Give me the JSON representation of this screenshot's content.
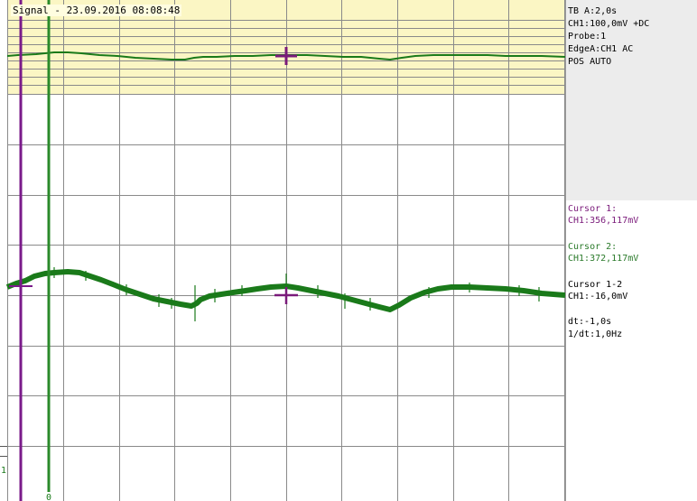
{
  "window": {
    "title": "Signal - 23.09.2016 08:08:48"
  },
  "info": {
    "tb": "TB A:2,0s",
    "ch1": "CH1:100,0mV +DC",
    "probe": "Probe:1",
    "edge": "EdgeA:CH1 AC",
    "mode": "POS AUTO"
  },
  "cursors": {
    "c1_label": "Cursor 1:",
    "c1_value": "CH1:356,117mV",
    "c2_label": "Cursor 2:",
    "c2_value": "CH1:372,117mV",
    "diff_label": "Cursor 1-2",
    "diff_value": "CH1:-16,0mV",
    "dt": "dt:-1,0s",
    "inv_dt": "1/dt:1,0Hz"
  },
  "markers": {
    "channel_marker": "1",
    "bottom_marker": "0"
  },
  "colors": {
    "trace": "#1a7a1a",
    "cursor1": "#7a1a8a",
    "cursor2": "#2a8a2a",
    "overview_bg": "#fbf6c4",
    "grid": "#7f7f7f"
  }
}
